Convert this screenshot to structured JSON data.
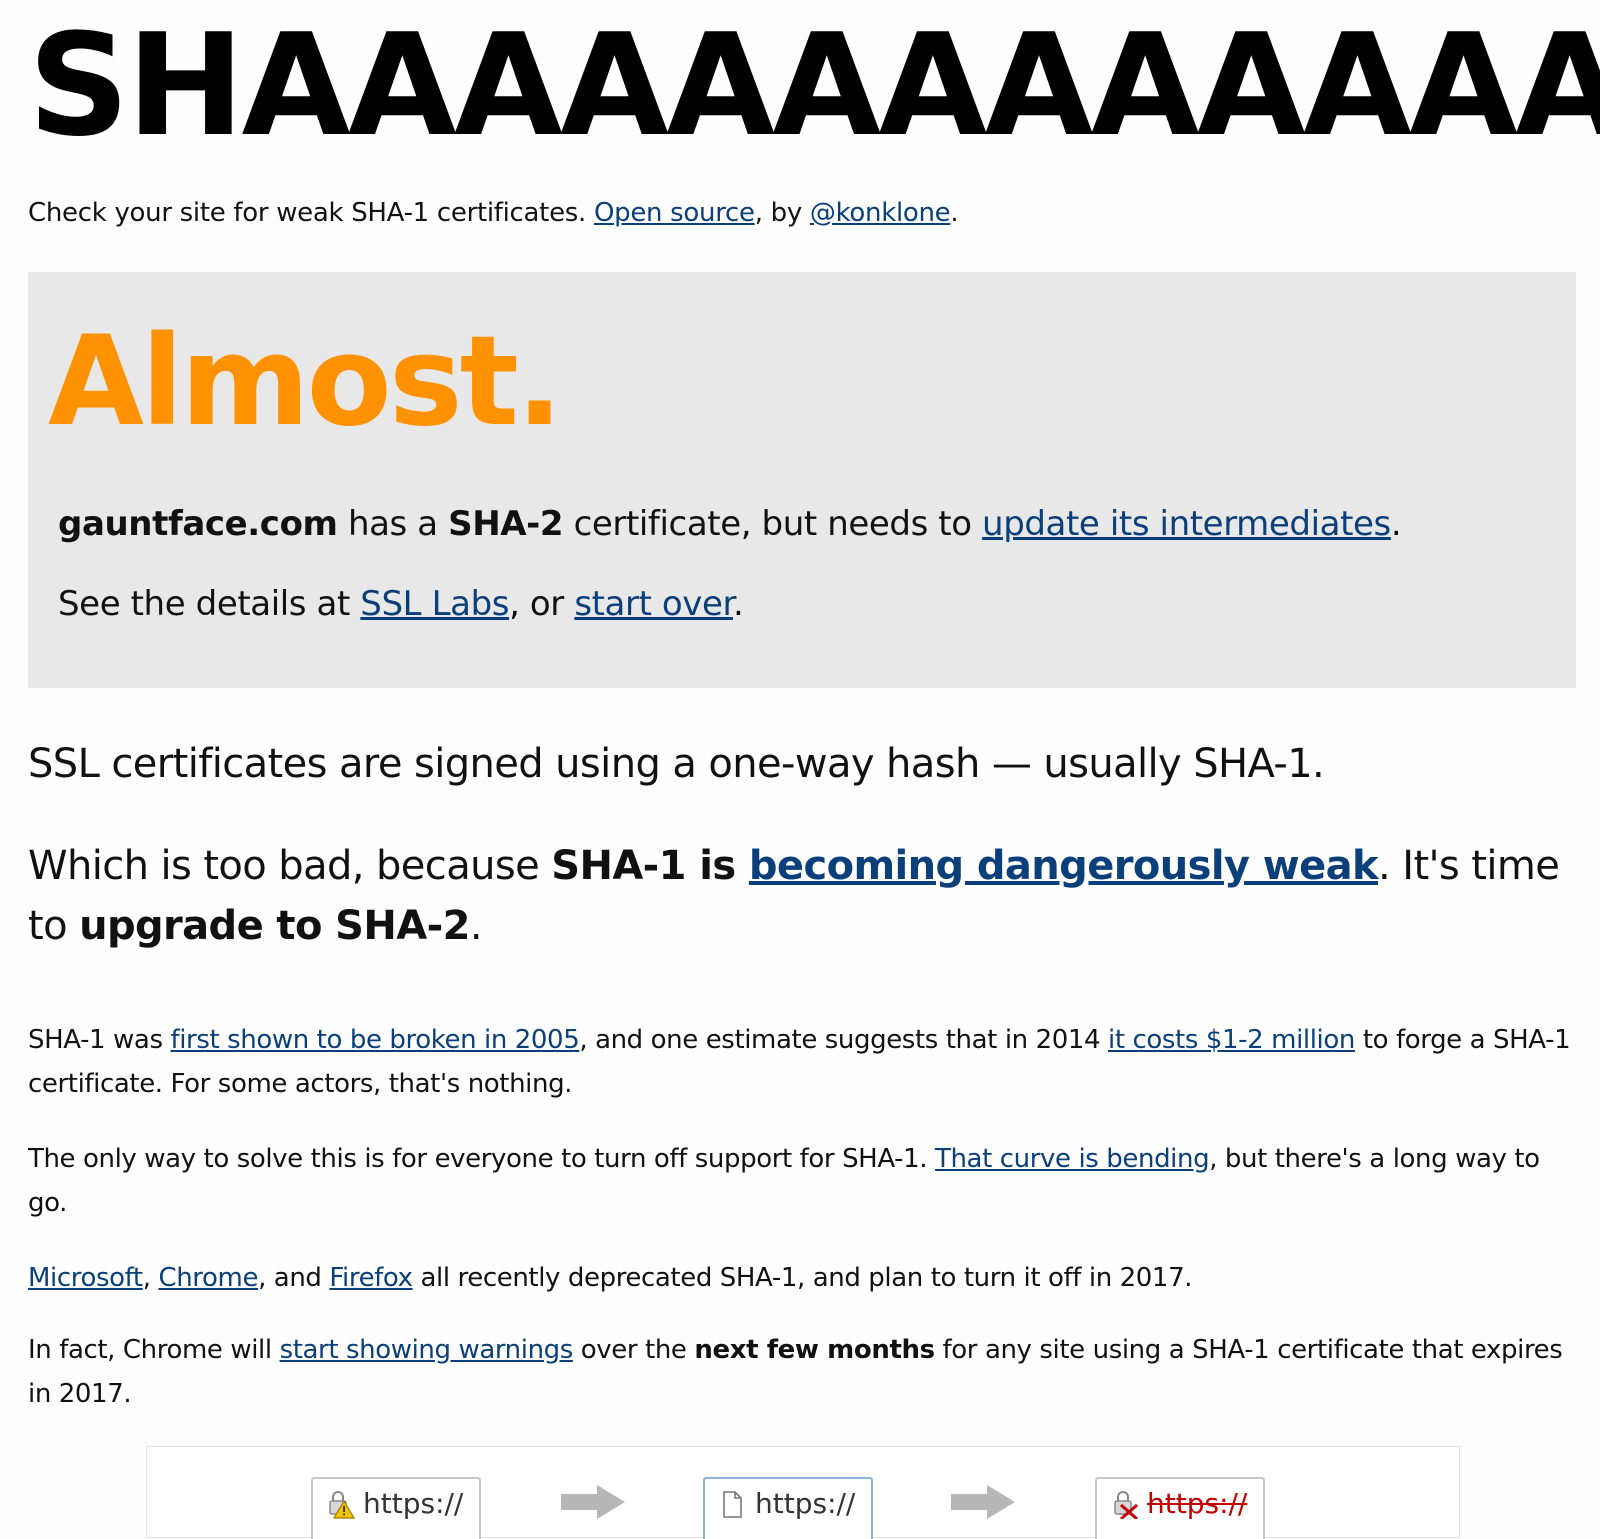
{
  "header": {
    "title": "SHAAAAAAAAAAAAA",
    "tagline_text": "Check your site for weak SHA-1 certificates. ",
    "open_source_link": "Open source",
    "by_text": ", by ",
    "author_link": "@konklone",
    "end_period": "."
  },
  "result": {
    "verdict": "Almost.",
    "domain": "gauntface.com",
    "has_a": " has a ",
    "cert_type": "SHA-2",
    "cert_suffix": " certificate, but needs to ",
    "update_link": "update its intermediates",
    "end_period": ".",
    "details_prefix": "See the details at ",
    "ssl_labs_link": "SSL Labs",
    "or_text": ", or ",
    "start_over_link": "start over",
    "details_period": "."
  },
  "lead": {
    "line1": "SSL certificates are signed using a one-way hash — usually SHA-1.",
    "line2_prefix": "Which is too bad, because ",
    "line2_bold": "SHA-1 is ",
    "line2_link": "becoming dangerously weak",
    "line2_mid": ". It's time to ",
    "line2_bold2": "upgrade to SHA-2",
    "line2_end": "."
  },
  "paragraphs": {
    "p1_a": "SHA-1 was ",
    "p1_link1": "first shown to be broken in 2005",
    "p1_b": ", and one estimate suggests that in 2014 ",
    "p1_link2": "it costs $1-2 million",
    "p1_c": " to forge a SHA-1 certificate. For some actors, that's nothing.",
    "p2_a": "The only way to solve this is for everyone to turn off support for SHA-1. ",
    "p2_link": "That curve is bending",
    "p2_b": ", but there's a long way to go.",
    "p3_link1": "Microsoft",
    "p3_sep1": ", ",
    "p3_link2": "Chrome",
    "p3_sep2": ", and ",
    "p3_link3": "Firefox",
    "p3_b": " all recently deprecated SHA-1, and plan to turn it off in 2017.",
    "p4_a": "In fact, Chrome will ",
    "p4_link": "start showing warnings",
    "p4_b": " over the ",
    "p4_bold": "next few months",
    "p4_c": " for any site using a SHA-1 certificate that expires in 2017."
  },
  "figure": {
    "url1": "https://",
    "url2": "https://",
    "url3": "https://",
    "icon1": "warning-lock-icon",
    "icon2": "page-icon",
    "icon3": "broken-lock-icon",
    "colors": {
      "warning": "#f5c400",
      "error": "#c40000",
      "arrow": "#b7b7b7"
    }
  },
  "colors": {
    "verdict": "#ff9203",
    "link": "#0b3f7a",
    "status_box_bg": "#e8e8e8"
  }
}
